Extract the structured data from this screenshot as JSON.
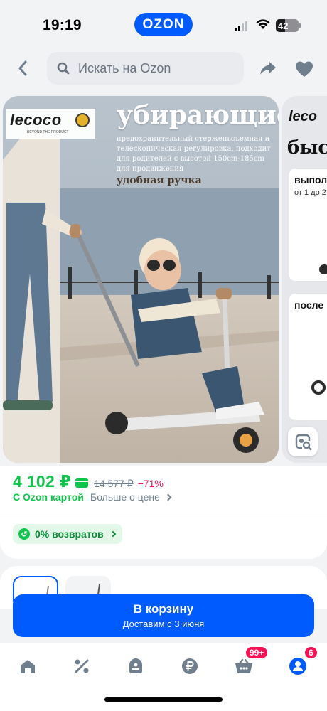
{
  "status_bar": {
    "time": "19:19",
    "logo": "OZON",
    "battery": "42",
    "battery_level": 0.42,
    "icons": [
      "signal-icon",
      "wifi-icon",
      "battery-icon"
    ]
  },
  "header": {
    "search_placeholder": "Искать на Ozon",
    "icons": [
      "back-arrow-icon",
      "search-icon",
      "share-icon",
      "heart-icon"
    ]
  },
  "gallery": {
    "brand": "lecoco",
    "brand_tagline": "BEYOND THE PRODUCT",
    "promo_title": "убирающиеся",
    "promo_description": "предохранительный стерженьсъемная и телескопическая регулировка, подходит для родителей с высотой 150cm-185cm для продвижения",
    "promo_handle": "удобная ручка",
    "next_slide": {
      "brand": "leco",
      "title": "быст",
      "label_1": "выпол",
      "label_2": "от 1 до 2",
      "label_3": "после"
    }
  },
  "price": {
    "current": "4 102 ₽",
    "old": "14 577 ₽",
    "discount": "−71%",
    "ozon_card_label": "С Ozon картой",
    "more_label": "Больше о цене"
  },
  "returns": {
    "icon_glyph": "↺",
    "label": "0% возвратов"
  },
  "cart": {
    "label": "В корзину",
    "delivery": "Доставим с 3 июня"
  },
  "bottom_nav": {
    "items": [
      "home",
      "discounts",
      "favorites",
      "payments",
      "cart",
      "profile"
    ],
    "cart_badge": "99+",
    "profile_badge": "6"
  },
  "colors": {
    "brand_blue": "#005bff",
    "price_green": "#10c44c",
    "discount_pink": "#f91155"
  }
}
